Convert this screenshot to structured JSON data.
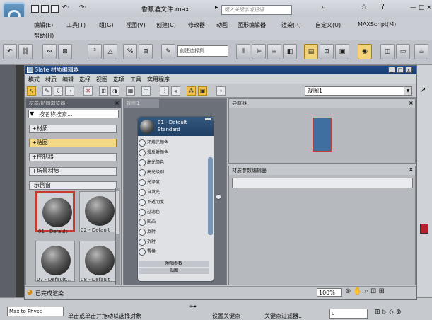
{
  "app": {
    "file_title": "香蕉酒文件.max",
    "search_placeholder": "键入关键字或短语",
    "menus": [
      "编辑(E)",
      "工具(T)",
      "组(G)",
      "视图(V)",
      "创建(C)",
      "修改器",
      "动画",
      "图形编辑器",
      "渲染(R)",
      "自定义(U)",
      "MAXScript(M)"
    ],
    "help_menu": "帮助(H)",
    "selection_set_placeholder": "创建选择集",
    "win_controls": [
      "—",
      "□",
      "×"
    ]
  },
  "slate": {
    "title": "Slate 材质编辑器",
    "menus": [
      "模式",
      "材质",
      "编辑",
      "选择",
      "视图",
      "选项",
      "工具",
      "实用程序"
    ],
    "win_controls": [
      "_",
      "□",
      "x"
    ],
    "view_dropdown": "视图1",
    "browser": {
      "header": "材质/贴图浏览器",
      "search_placeholder": "按名称搜索...",
      "categories": [
        {
          "label": "+材质",
          "selected": false
        },
        {
          "label": "+贴图",
          "selected": true
        },
        {
          "label": "+控制器",
          "selected": false
        },
        {
          "label": "+场景材质",
          "selected": false
        },
        {
          "label": "-示例窗",
          "selected": false
        }
      ],
      "swatches": [
        "01 - Default",
        "02 - Default",
        "07 - Default...",
        "08 - Default"
      ]
    },
    "view_tab": "视图1",
    "node": {
      "title": "01 - Default",
      "subtitle": "Standard",
      "slots": [
        "环境光颜色",
        "漫反射颜色",
        "高光颜色",
        "高光级别",
        "光泽度",
        "自发光",
        "不透明度",
        "过滤色",
        "凹凸",
        "反射",
        "折射",
        "置换"
      ],
      "extended_params": "附加参数",
      "maps": "贴图"
    },
    "navigator_header": "导航器",
    "params_header": "材质参数编辑器",
    "status": "已完成渲染",
    "zoom": "100%"
  },
  "statusbar": {
    "maxscript": "Max to Physc",
    "prompt": "单击或单击并拖动以选择对象",
    "set_key": "设置关键点",
    "key_filter": "关键点过滤器...",
    "frame": "0"
  }
}
